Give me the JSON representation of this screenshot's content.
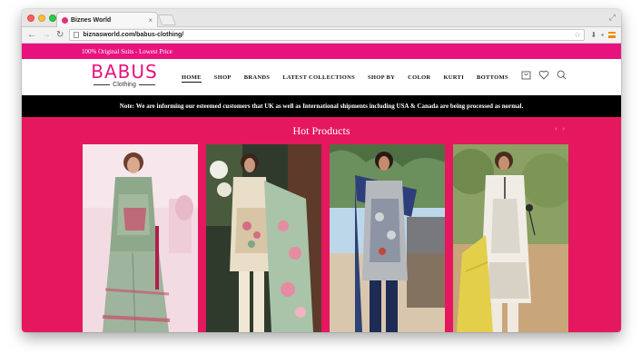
{
  "browser": {
    "tab_title": "Biznes World",
    "url": "biznasworld.com/babus-clothing/"
  },
  "site": {
    "topbar_text": "100% Original Suits - Lowest Price",
    "logo_main": "BABUS",
    "logo_sub": "Clothing",
    "nav": [
      "HOME",
      "SHOP",
      "BRANDS",
      "LATEST COLLECTIONS",
      "SHOP BY",
      "COLOR",
      "KURTI",
      "BOTTOMS"
    ],
    "notice": "Note: We are informing our esteemed customers that UK as well as International shipments including USA & Canada are being processed as normal.",
    "section_title": "Hot Products",
    "header_icons": [
      "cart-icon",
      "heart-icon",
      "search-icon"
    ],
    "colors": {
      "brand_pink": "#e8127e",
      "section_bg": "#e5175e",
      "notice_bg": "#000000"
    },
    "products": [
      {
        "icon": "product-image-green-sharara-suit"
      },
      {
        "icon": "product-image-beige-embroidered-lawn-suit"
      },
      {
        "icon": "product-image-grey-printed-lawn-suit"
      },
      {
        "icon": "product-image-white-embroidered-suit"
      }
    ]
  }
}
